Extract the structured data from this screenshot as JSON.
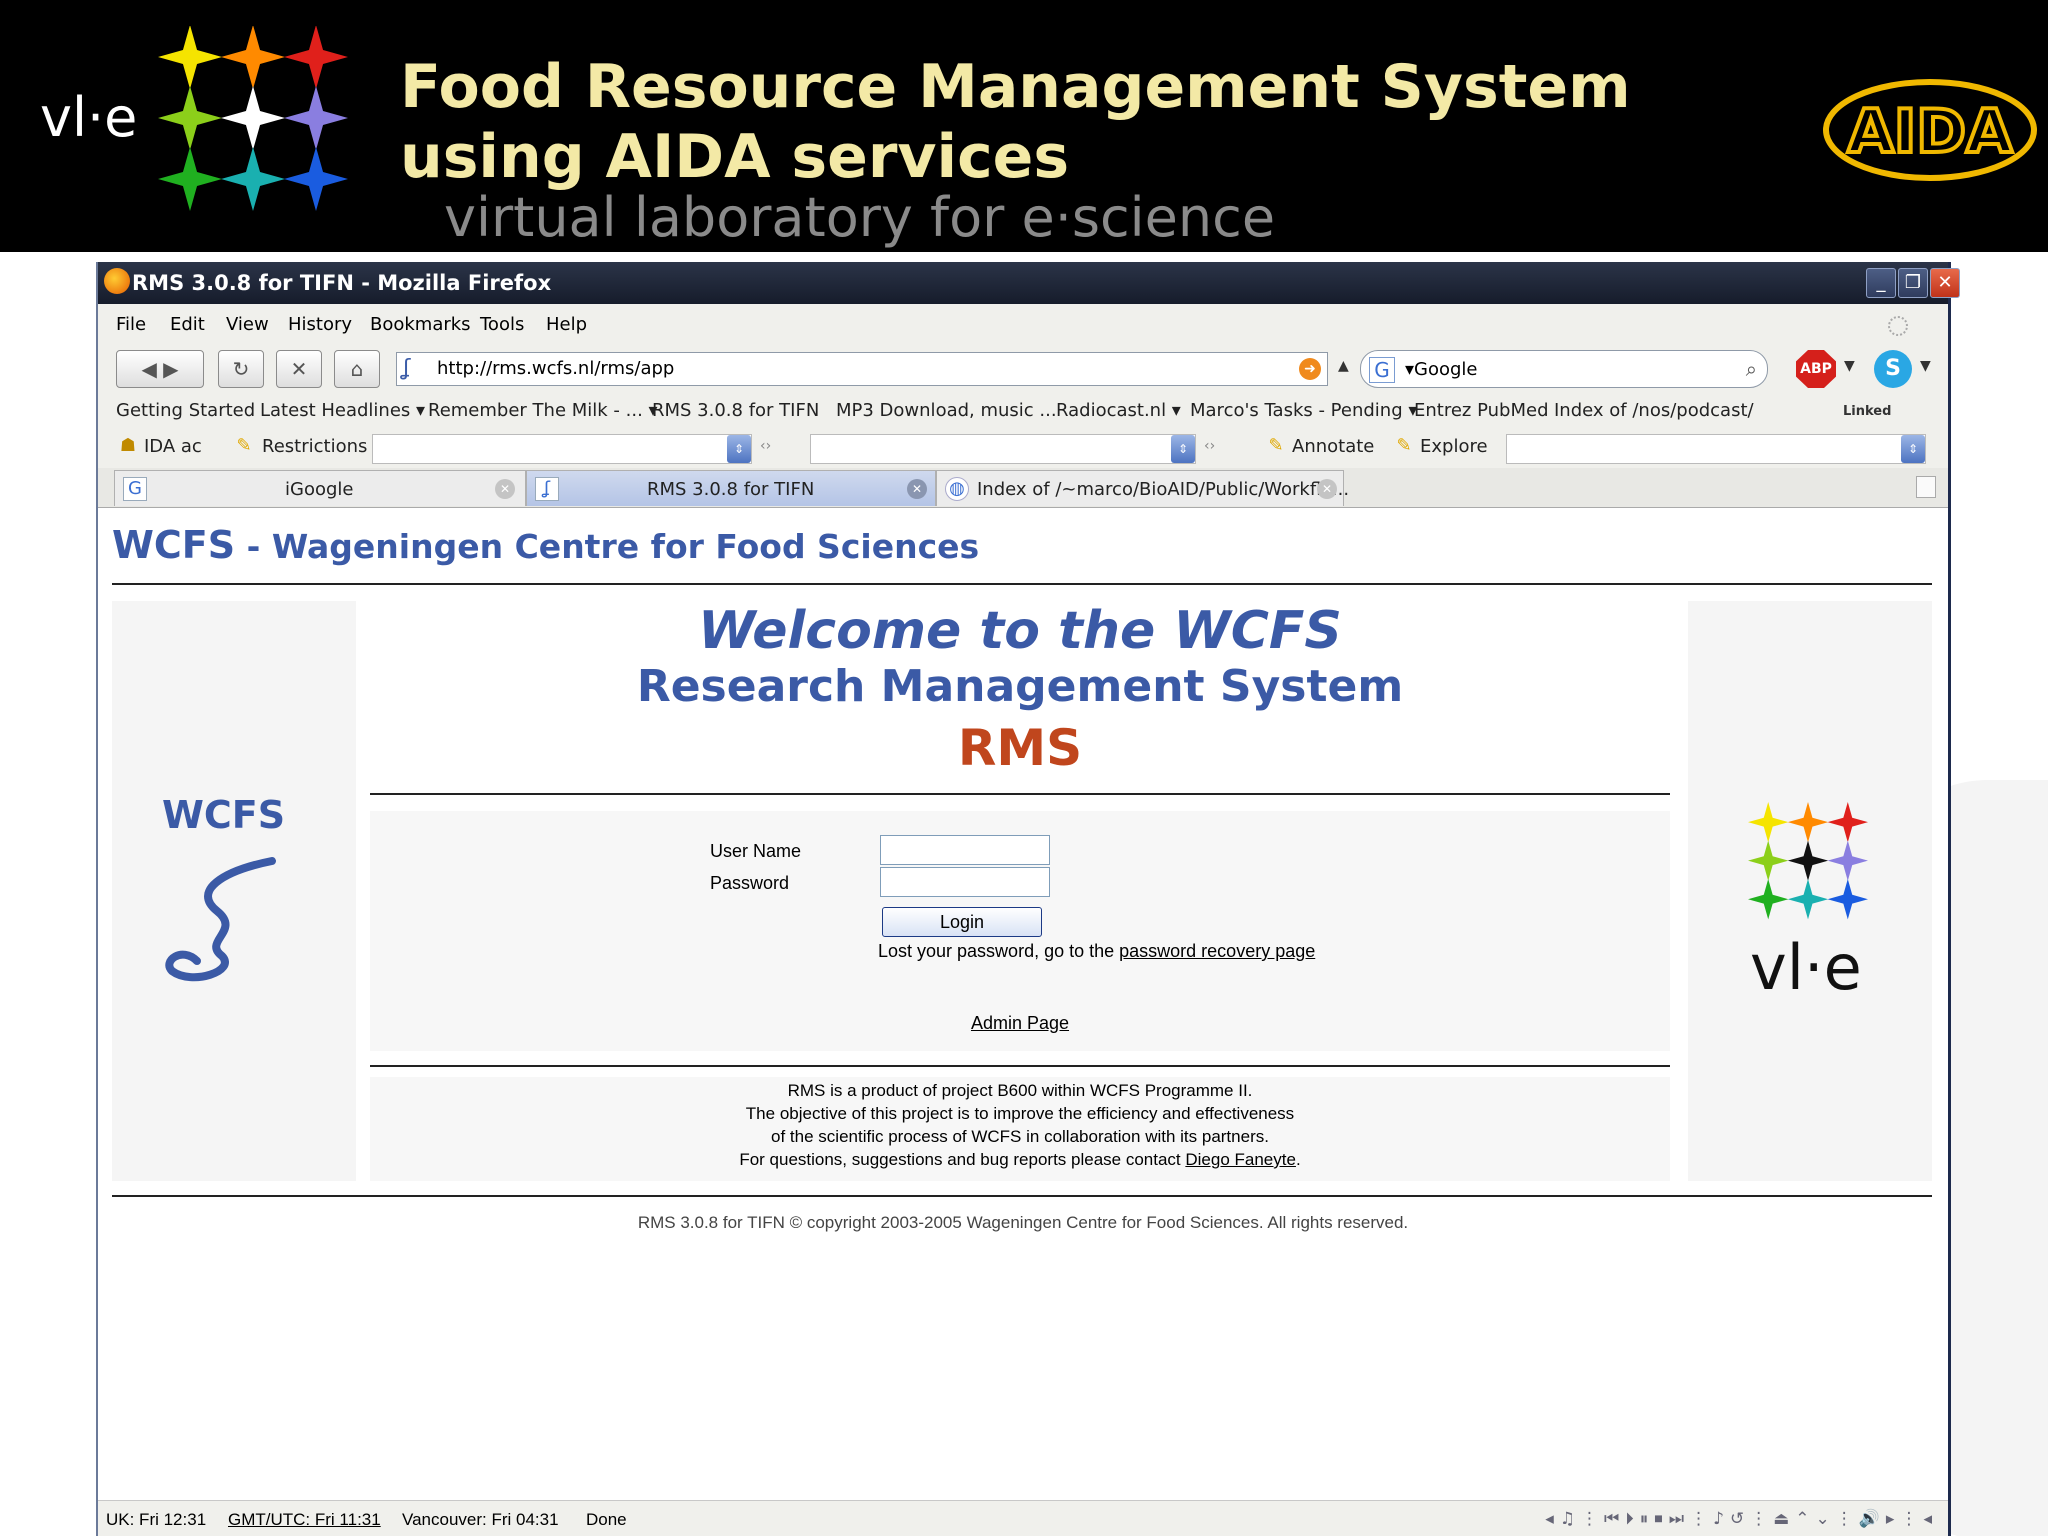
{
  "slide": {
    "vle_logo": "vl·e",
    "title_line1": "Food Resource Management System",
    "title_line2": "using AIDA services",
    "subtitle": "virtual laboratory for e·science",
    "aida_logo": "AIDA"
  },
  "window": {
    "title": "RMS 3.0.8 for TIFN - Mozilla Firefox",
    "buttons": [
      "minimize",
      "restore",
      "close"
    ]
  },
  "menubar": [
    "File",
    "Edit",
    "View",
    "History",
    "Bookmarks",
    "Tools",
    "Help"
  ],
  "navbar": {
    "url": "http://rms.wcfs.nl/rms/app",
    "search_engine": "Google",
    "search_text": "▾Google",
    "abp_label": "ABP"
  },
  "bookmarks": [
    "Getting Started",
    "Latest Headlines ▾",
    "Remember The Milk - ... ▾",
    "RMS 3.0.8 for TIFN",
    "MP3 Download, music ...",
    "Radiocast.nl ▾",
    "Marco's Tasks - Pending ▾",
    "Entrez PubMed",
    "Index of /nos/podcast/",
    "Linked"
  ],
  "toolbar2": {
    "ida": "IDA ac",
    "restrictions": "Restrictions",
    "annotate": "Annotate",
    "explore": "Explore"
  },
  "tabs": [
    {
      "label": "iGoogle",
      "icon": "google-icon"
    },
    {
      "label": "RMS 3.0.8 for TIFN",
      "icon": "wcfs-icon",
      "active": true
    },
    {
      "label": "Index of /~marco/BioAID/Public/Workflo...",
      "icon": "globe-icon"
    }
  ],
  "page": {
    "header_abbr": "WCFS",
    "header_full": " - Wageningen Centre for Food Sciences",
    "welcome1": "Welcome to the WCFS",
    "welcome2": "Research Management System",
    "welcome3": "RMS",
    "left_logo": "WCFS",
    "right_logo": "vl·e",
    "login": {
      "username_label": "User Name",
      "password_label": "Password",
      "username_value": "",
      "password_value": "",
      "button": "Login",
      "lost_text": "Lost your password, go to the ",
      "lost_link": "password recovery page"
    },
    "admin_link": "Admin Page",
    "info": [
      "RMS is a product of project B600 within WCFS Programme II.",
      "The objective of this project is to improve the efficiency and effectiveness",
      "of the scientific process of WCFS in collaboration with its partners."
    ],
    "contact_text": "For questions, suggestions and bug reports please contact ",
    "contact_link": "Diego Faneyte",
    "contact_end": ".",
    "copyright": "RMS 3.0.8 for TIFN © copyright 2003-2005 Wageningen Centre for Food Sciences. All rights reserved."
  },
  "statusbar": {
    "uk": "UK: Fri 12:31",
    "gmt": "GMT/UTC: Fri 11:31",
    "vancouver": "Vancouver: Fri 04:31",
    "status": "Done"
  },
  "colors": {
    "wcfs_blue": "#3b5aa6",
    "rms_orange": "#c0461d",
    "title_yellow": "#f3e9a6",
    "aida_gold": "#f0b800"
  }
}
